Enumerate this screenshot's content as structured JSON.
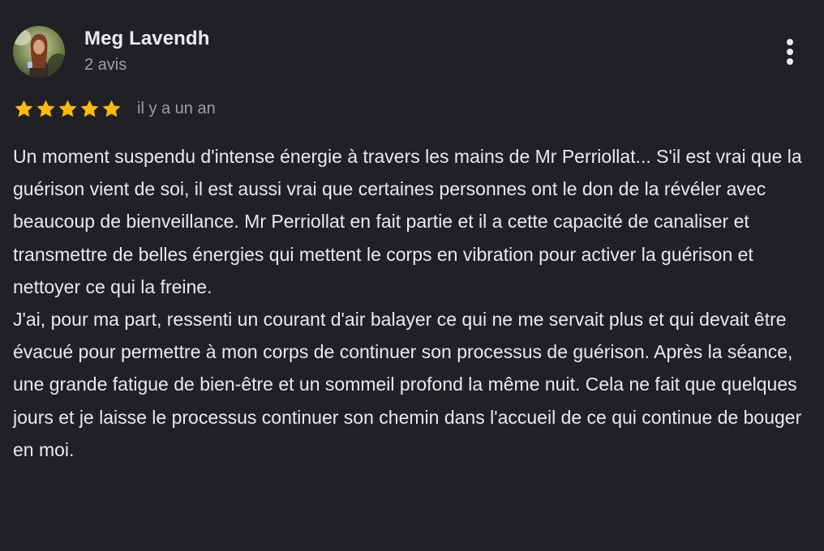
{
  "review": {
    "author_name": "Meg Lavendh",
    "review_count": "2 avis",
    "rating": 5,
    "rating_max": 5,
    "time_ago": "il y a un an",
    "star_color": "#fbbc04",
    "paragraphs": [
      "Un moment suspendu d'intense énergie à travers les mains de Mr Perriollat... S'il est vrai que la guérison vient de soi, il est aussi vrai que certaines personnes ont le don de la révéler avec beaucoup de bienveillance. Mr Perriollat en fait partie et il a cette capacité de canaliser et transmettre de belles énergies qui mettent le corps en vibration pour activer la guérison et nettoyer ce qui la freine.",
      "J'ai, pour ma part, ressenti un courant d'air balayer ce qui ne me servait plus et qui devait être évacué pour permettre à mon corps de continuer son processus de guérison. Après la séance, une grande fatigue de bien-être et un sommeil profond la même nuit. Cela ne fait que quelques jours et je laisse le processus continuer son chemin dans l'accueil de ce qui continue de bouger en moi."
    ],
    "more_icon": "more-vert-icon"
  }
}
